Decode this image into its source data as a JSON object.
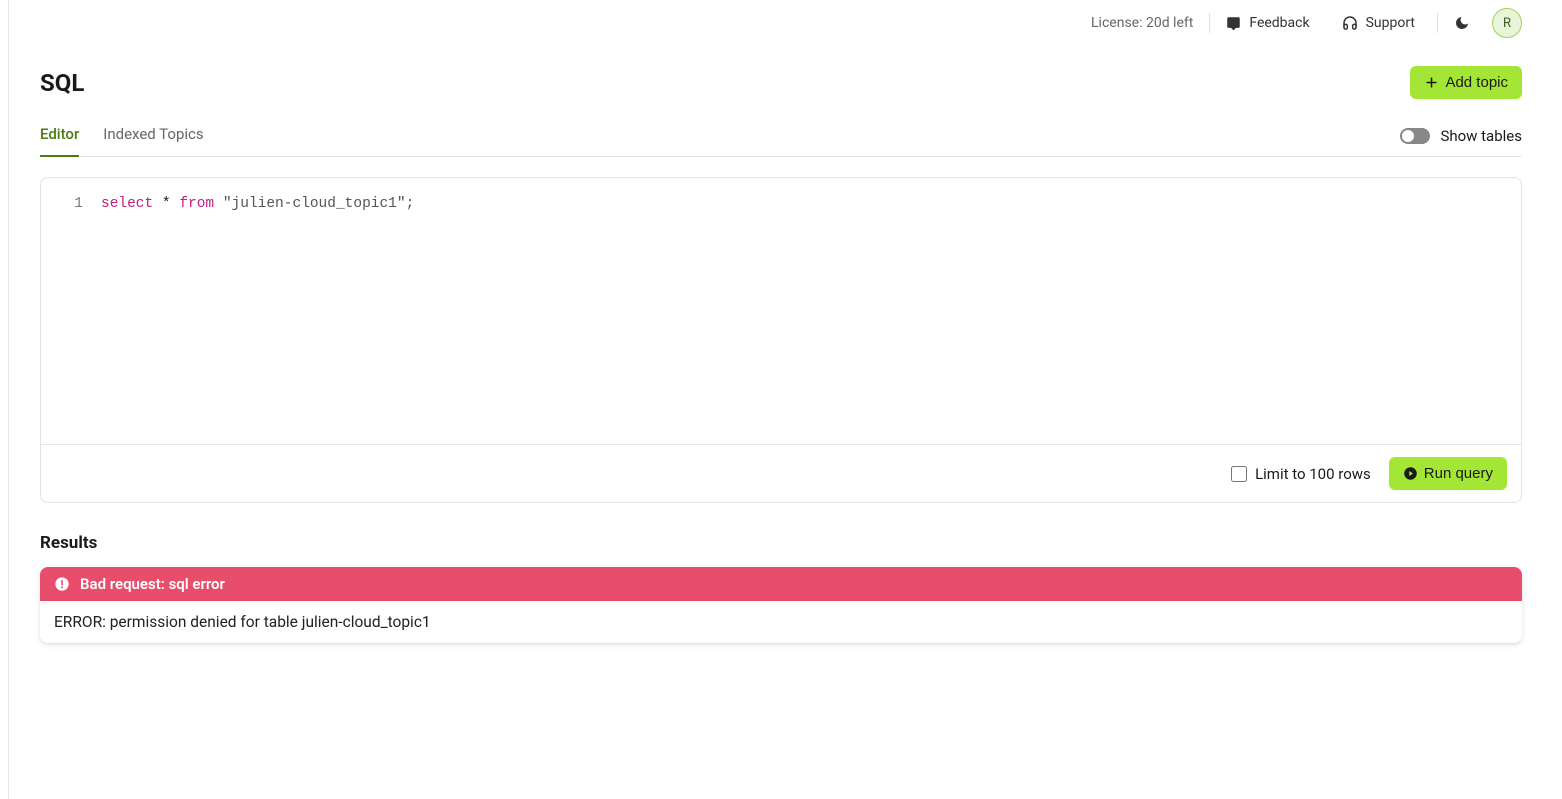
{
  "topbar": {
    "license_text": "License: 20d left",
    "feedback_label": "Feedback",
    "support_label": "Support",
    "avatar_initial": "R"
  },
  "page": {
    "title": "SQL",
    "add_topic_label": "Add topic"
  },
  "tabs": {
    "editor": "Editor",
    "indexed_topics": "Indexed Topics",
    "show_tables_label": "Show tables"
  },
  "editor": {
    "line_number": "1",
    "code_kw1": "select",
    "code_star": " * ",
    "code_kw2": "from",
    "code_space": " ",
    "code_str": "\"julien-cloud_topic1\"",
    "code_semi": ";",
    "limit_label": "Limit to 100 rows",
    "run_label": "Run query"
  },
  "results": {
    "title": "Results",
    "error_title": "Bad request: sql error",
    "error_body": "ERROR: permission denied for table julien-cloud_topic1"
  }
}
